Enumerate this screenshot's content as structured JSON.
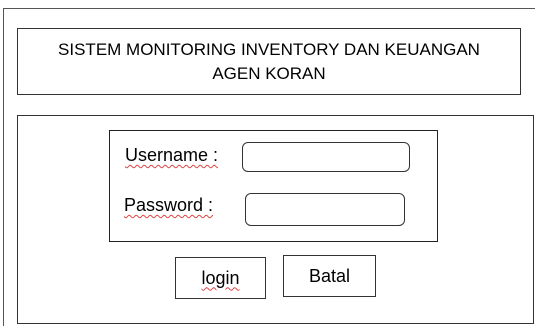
{
  "header": {
    "title": "SISTEM MONITORING INVENTORY DAN KEUANGAN\nAGEN KORAN"
  },
  "form": {
    "username_label": "Username :",
    "username_value": "",
    "password_label": "Password :",
    "password_value": ""
  },
  "buttons": {
    "login_label": "login",
    "cancel_label": "Batal"
  },
  "colors": {
    "border": "#333333",
    "background": "#ffffff",
    "spellcheck_underline": "#dd4444"
  }
}
